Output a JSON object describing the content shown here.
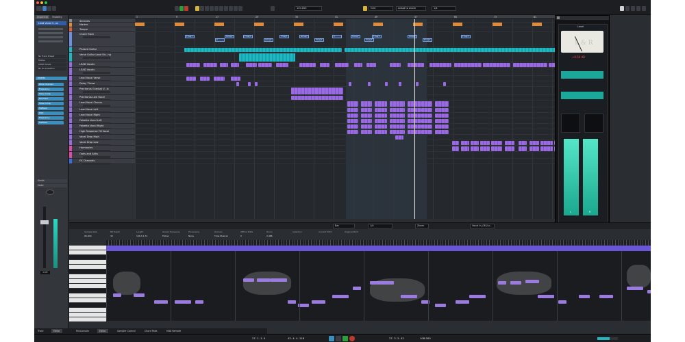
{
  "inspector": {
    "tabs": [
      "Inspector",
      "Visibility"
    ],
    "track_name": "Lead Vocal C..us",
    "rows": [
      "No Track Preset",
      "Modus",
      "LEAD Vocals",
      "No Drumstation"
    ],
    "inserts_label": "Inserts",
    "inserts": [
      "RVox Channel",
      "Frequency",
      "Tube Comp",
      "De Esser",
      "Tube Comp",
      "DeEsser",
      "Pilot",
      "Frequency",
      "DeEsser"
    ],
    "sends_label": "Sends",
    "fader_label": "Fader",
    "fader_value": "0.00"
  },
  "ruler": {
    "labels": [
      "1",
      "9",
      "17",
      "25",
      "33",
      "41",
      "49",
      "57",
      "65",
      "73",
      "81",
      "89"
    ]
  },
  "tracks": [
    {
      "name": "Seconds",
      "color": "#8a8d92"
    },
    {
      "name": "Marker",
      "color": "#e08a3a"
    },
    {
      "name": "Tempo",
      "color": "#e0603a"
    },
    {
      "name": "Chord Track",
      "color": "#6f8fe0"
    },
    {
      "name": "Phased Guitar",
      "color": "#1fb8c2"
    },
    {
      "name": "Verse Guitar Lead Str...ng",
      "color": "#1fb8c2"
    },
    {
      "name": "LEAD Vocals",
      "color": "#9a6be0"
    },
    {
      "name": "LEAD Vocals",
      "color": "#9a6be0"
    },
    {
      "name": "Lead Vocal Verse",
      "color": "#9a6be0"
    },
    {
      "name": "Delay Throw",
      "color": "#9a6be0"
    },
    {
      "name": "Prechorus Gradual V...ls",
      "color": "#9a6be0"
    },
    {
      "name": "Prechorus Low Vocal",
      "color": "#9a6be0"
    },
    {
      "name": "Lead Vocal Chorus",
      "color": "#9a6be0"
    },
    {
      "name": "Lead Vocal Left",
      "color": "#9a6be0"
    },
    {
      "name": "Lead Vocal Right",
      "color": "#9a6be0"
    },
    {
      "name": "Falsetto Vocal Left",
      "color": "#9a6be0"
    },
    {
      "name": "Falsetto Vocal Right",
      "color": "#9a6be0"
    },
    {
      "name": "High Response Fill Vocal",
      "color": "#9a6be0"
    },
    {
      "name": "Vocal Drop High",
      "color": "#9a6be0"
    },
    {
      "name": "Vocal Drop Low",
      "color": "#9a6be0"
    },
    {
      "name": "Harmonies",
      "color": "#e04aa8"
    },
    {
      "name": "Oohs and Ahhs",
      "color": "#e04aa8"
    },
    {
      "name": "FX Channels",
      "color": "#3a6be0"
    }
  ],
  "chords": [
    "Fmaj7",
    "C",
    "Cmaj7",
    "Fmaj7",
    "Amaj7",
    "Fmaj7",
    "Gmaj7",
    "Fmaj7",
    "C",
    "Cmaj7",
    "Fmaj7",
    "Fmaj7",
    "Cmaj7",
    "Fmaj7",
    "Fmaj7"
  ],
  "supervision": {
    "module": "Level",
    "meter_text": "L & R",
    "readout": "+0.50 dB",
    "labels": [
      "L",
      "R"
    ],
    "brand": "steinberg",
    "product": "supervision"
  },
  "toolbar": {
    "tempo_field": "120.000",
    "grid_label": "Grid",
    "zoom_label": "Adapt to Zoom",
    "quant_label": "1/4"
  },
  "lower": {
    "toolbar_fields": [
      "Bar",
      "1/4",
      "Zoom"
    ],
    "track_field": "Vocal In_08 (Lo...",
    "info_labels": [
      "Sample Rate",
      "Bit Depth",
      "Length",
      "Global Transpose",
      "Processing",
      "Domain",
      "Offline Edits",
      "Zoom",
      "Selection",
      "Current Pitch",
      "Original Pitch"
    ],
    "info_values": [
      "96.000",
      "32",
      "146.3.1.74",
      "Follow",
      "None",
      "Time Musical",
      "0",
      "2.486",
      "",
      "",
      ""
    ]
  },
  "bottom_tabs": [
    "Track",
    "Editor",
    "MixConsole",
    "Editor",
    "Sampler Control",
    "Chord Pads",
    "MIDI Remote"
  ],
  "transport": {
    "left_pos": "27. 1. 1. 0",
    "right_pos": "42. 4. 4. 116",
    "position": "27. 3. 2. 42",
    "tempo": "108.000"
  }
}
